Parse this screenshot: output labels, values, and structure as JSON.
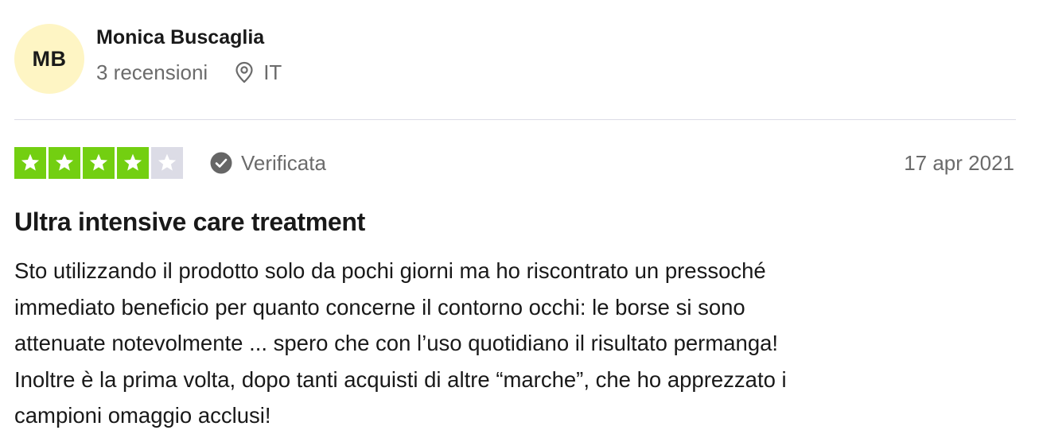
{
  "consumer": {
    "initials": "MB",
    "name": "Monica Buscaglia",
    "reviews_count": "3 recensioni",
    "country": "IT",
    "avatar_color": "#fef5c4"
  },
  "review": {
    "rating": 4,
    "max_rating": 5,
    "star_fill_color": "#73cf11",
    "star_empty_color": "#dcdce6",
    "verified_label": "Verificata",
    "date": "17 apr 2021",
    "title": "Ultra intensive care treatment",
    "body": "Sto utilizzando il prodotto solo da pochi giorni ma ho riscontrato un pressoché\nimmediato beneficio per quanto concerne il contorno occhi: le borse si sono\nattenuate notevolmente ... spero che con l’uso quotidiano il risultato permanga!\nInoltre è la prima volta, dopo tanti acquisti di altre “marche”, che ho apprezzato i\ncampioni omaggio acclusi!"
  },
  "icons": {
    "location": "location-pin-icon",
    "verified": "check-circle-icon",
    "star": "star-icon"
  }
}
